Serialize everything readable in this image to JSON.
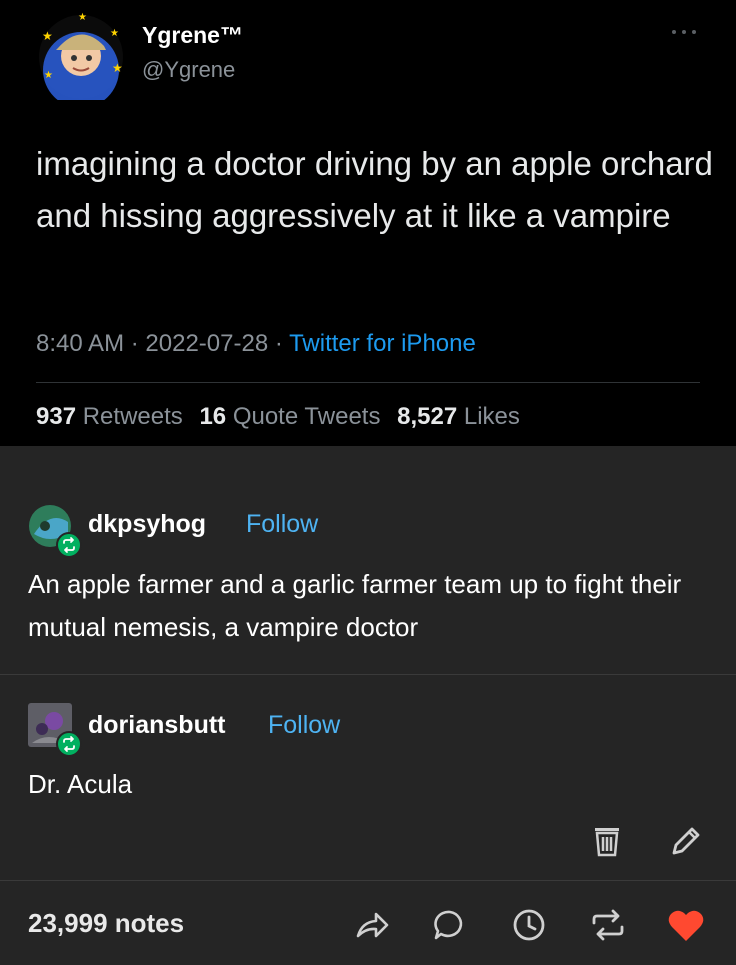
{
  "tweet": {
    "display_name": "Ygrene™",
    "handle": "@Ygrene",
    "text": "imagining a doctor driving by an apple orchard and hissing aggressively at it like a vampire",
    "time": "8:40 AM",
    "date": "2022-07-28",
    "source": "Twitter for iPhone",
    "separator": "·",
    "retweets_count": "937",
    "retweets_label": "Retweets",
    "quote_count": "16",
    "quote_label": "Quote Tweets",
    "likes_count": "8,527",
    "likes_label": "Likes",
    "more_icon": "more-dots-icon"
  },
  "reblogs": [
    {
      "username": "dkpsyhog",
      "follow_label": "Follow",
      "text": "An apple farmer and a garlic farmer team up to fight their mutual nemesis, a vampire doctor"
    },
    {
      "username": "doriansbutt",
      "follow_label": "Follow",
      "text": "Dr. Acula"
    }
  ],
  "footer": {
    "notes": "23,999 notes",
    "icons": [
      "delete-icon",
      "edit-icon",
      "share-icon",
      "reply-icon",
      "queue-icon",
      "reblog-icon",
      "like-icon"
    ]
  },
  "colors": {
    "tweet_bg": "#000000",
    "post_bg": "#252525",
    "link_blue": "#1d9bf0",
    "follow_blue": "#4eb3f2",
    "reblog_green": "#01b060",
    "like_red": "#ff4930"
  }
}
